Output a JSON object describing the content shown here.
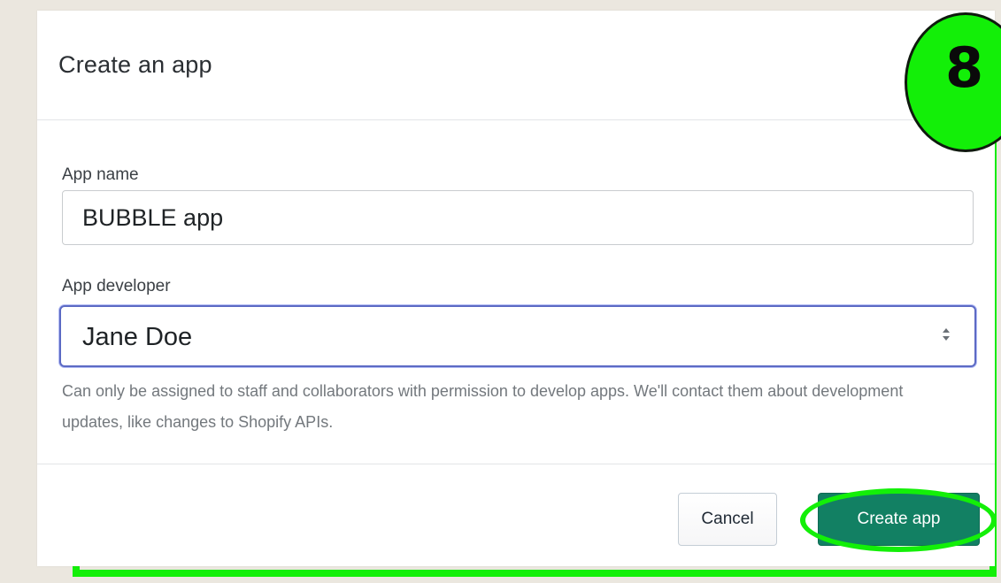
{
  "modal": {
    "title": "Create an app",
    "app_name": {
      "label": "App name",
      "value": "BUBBLE app"
    },
    "app_developer": {
      "label": "App developer",
      "selected": "Jane Doe",
      "help_text": "Can only be assigned to staff and collaborators with permission to develop apps. We'll contact them about development updates, like changes to Shopify APIs."
    },
    "buttons": {
      "cancel": "Cancel",
      "create": "Create app"
    }
  },
  "annotation": {
    "step_number": "8",
    "highlight_color": "#13ef08"
  },
  "colors": {
    "primary_button": "#128063",
    "focus_border": "#5c6ac4",
    "page_background": "#ebe7df"
  },
  "icons": {
    "select_arrows": "updown-chevron-icon"
  }
}
